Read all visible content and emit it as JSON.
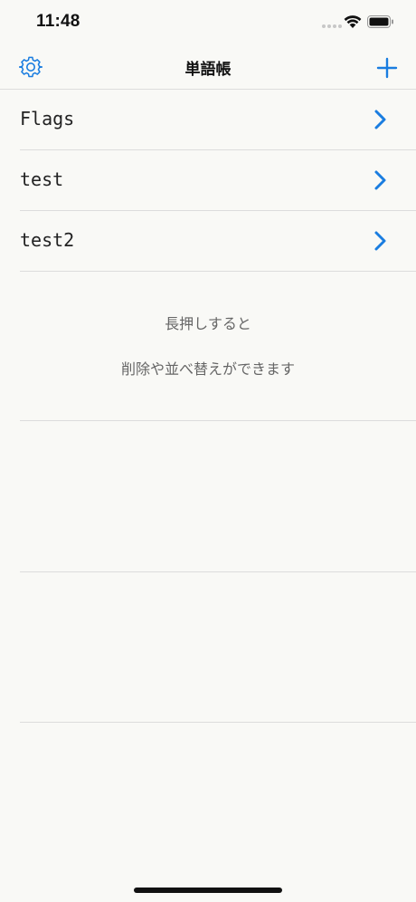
{
  "status_bar": {
    "time": "11:48"
  },
  "nav": {
    "title": "単語帳",
    "settings_icon": "gear-icon",
    "add_icon": "plus-icon"
  },
  "decks": [
    {
      "label": "Flags"
    },
    {
      "label": "test"
    },
    {
      "label": "test2"
    }
  ],
  "hint": {
    "line1": "長押しすると",
    "line2": "削除や並べ替えができます"
  },
  "colors": {
    "accent": "#1a7de0",
    "background": "#f9f9f6",
    "divider": "#dcdcdc",
    "hint_text": "#666666"
  }
}
